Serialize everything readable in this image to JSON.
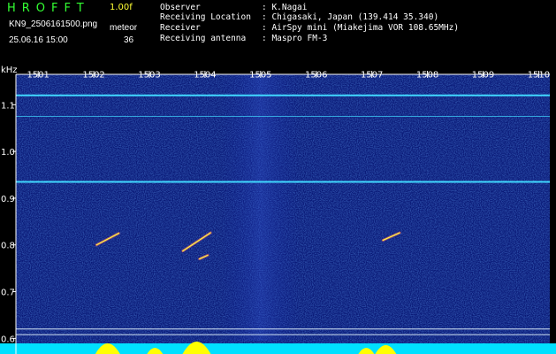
{
  "header": {
    "app_title": "HROFFT",
    "version": "1.00f",
    "filename": "KN9_2506161500.png",
    "datetime": "25.06.16 15:00",
    "meteor_label": "meteor",
    "meteor_count": "36",
    "info": [
      {
        "key": "Observer",
        "value": ": K.Nagai"
      },
      {
        "key": "Receiving Location",
        "value": ": Chigasaki, Japan (139.414 35.340)"
      },
      {
        "key": "Receiver",
        "value": ": AirSpy mini (Miakejima VOR 108.65MHz)"
      },
      {
        "key": "Receiving antenna",
        "value": ": Maspro FM-3"
      }
    ]
  },
  "colors": {
    "background": "#000000",
    "spectrogram": "#0a1a78",
    "carrier": "#40d8ff",
    "meteor": "#ffff40",
    "axis": "#ffffff",
    "header_title": "#33ff33",
    "header_version": "#ffff33",
    "activity_bar": "#ffff00",
    "noise_floor": "#00e0ff"
  },
  "chart_data": {
    "type": "heatmap",
    "title": "",
    "xlabel": "",
    "ylabel": "kHz",
    "x_ticks": [
      "1501",
      "1502",
      "1503",
      "1504",
      "1505",
      "1506",
      "1507",
      "1508",
      "1509",
      "1510"
    ],
    "y_ticks": [
      "1.1",
      "1.0",
      "0.9",
      "0.8",
      "0.7",
      "0.6"
    ],
    "x_range": [
      1500.6,
      1510.2
    ],
    "y_range": [
      0.595,
      1.165
    ],
    "grid": false,
    "carrier_lines_khz": [
      1.12,
      1.075,
      0.935,
      0.62,
      0.608
    ],
    "meteor_echoes": [
      {
        "x_start": 1502.05,
        "x_end": 1502.45,
        "y_start": 0.8,
        "y_end": 0.825
      },
      {
        "x_start": 1503.6,
        "x_end": 1504.1,
        "y_start": 0.787,
        "y_end": 0.826
      },
      {
        "x_start": 1503.9,
        "x_end": 1504.05,
        "y_start": 0.77,
        "y_end": 0.778
      },
      {
        "x_start": 1507.2,
        "x_end": 1507.5,
        "y_start": 0.81,
        "y_end": 0.826
      }
    ],
    "activity_peaks": [
      {
        "x": 1502.25,
        "level": 0.8
      },
      {
        "x": 1503.85,
        "level": 1.0
      },
      {
        "x": 1507.25,
        "level": 0.6
      },
      {
        "x": 1503.1,
        "level": 0.3
      },
      {
        "x": 1506.9,
        "level": 0.3
      }
    ]
  }
}
